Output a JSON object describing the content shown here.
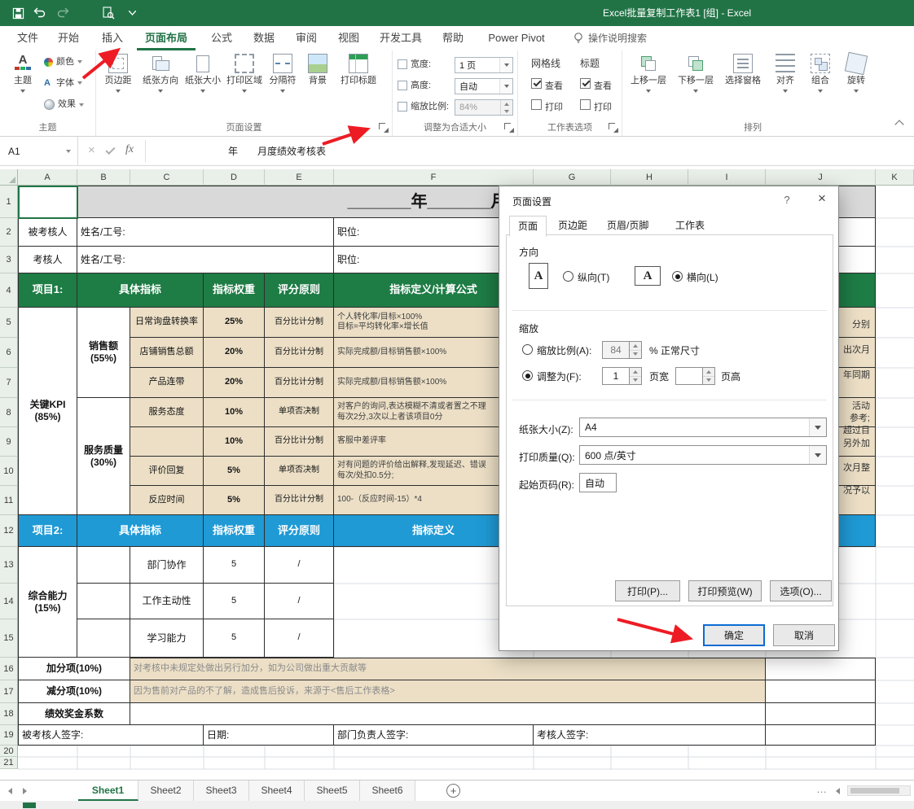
{
  "titlebar": {
    "title": "Excel批量复制工作表1 [组] -  Excel"
  },
  "tabs": {
    "file": "文件",
    "home": "开始",
    "insert": "插入",
    "page_layout": "页面布局",
    "formulas": "公式",
    "data": "数据",
    "review": "审阅",
    "view": "视图",
    "developer": "开发工具",
    "help": "帮助",
    "power_pivot": "Power Pivot",
    "search": "操作说明搜索"
  },
  "ribbon": {
    "themes": {
      "group": "主题",
      "theme": "主题",
      "colors": "颜色",
      "fonts": "字体",
      "effects": "效果"
    },
    "page_setup": {
      "group": "页面设置",
      "margins": "页边距",
      "orientation": "纸张方向",
      "size": "纸张大小",
      "print_area": "打印区域",
      "breaks": "分隔符",
      "background": "背景",
      "print_titles": "打印标题"
    },
    "scale": {
      "group": "调整为合适大小",
      "width_label": "宽度:",
      "width_value": "1 页",
      "height_label": "高度:",
      "height_value": "自动",
      "scale_label": "缩放比例:",
      "scale_value": "84%"
    },
    "sheet_options": {
      "group": "工作表选项",
      "gridlines": "网格线",
      "headings": "标题",
      "view": "查看",
      "print": "打印"
    },
    "arrange": {
      "group": "排列",
      "bring_forward": "上移一层",
      "send_backward": "下移一层",
      "selection_pane": "选择窗格",
      "align": "对齐",
      "group_btn": "组合",
      "rotate": "旋转"
    }
  },
  "formula_bar": {
    "name_box": "A1",
    "fx": "fx",
    "content": "年　　月度绩效考核表"
  },
  "grid": {
    "cols": [
      "A",
      "B",
      "C",
      "D",
      "E",
      "F",
      "G",
      "H",
      "I",
      "J",
      "K"
    ],
    "rows": [
      "1",
      "2",
      "3",
      "4",
      "5",
      "6",
      "7",
      "8",
      "9",
      "10",
      "11",
      "12",
      "13",
      "14",
      "15",
      "16",
      "17",
      "18",
      "19",
      "20",
      "21"
    ]
  },
  "table": {
    "title": "_______年_______月度绩效考核表",
    "assessed_label": "被考核人",
    "assessor_label": "考核人",
    "name_label": "姓名/工号:",
    "position_label": "职位:",
    "p1": {
      "a": "项目1:",
      "b": "具体指标",
      "c": "指标权重",
      "d": "评分原则",
      "e": "指标定义/计算公式"
    },
    "kpi": {
      "l1": "关键KPI",
      "l2": "(85%)"
    },
    "sales": {
      "l1": "销售额",
      "l2": "(55%)"
    },
    "service": {
      "l1": "服务质量",
      "l2": "(30%)"
    },
    "kpi_rows": [
      {
        "name": "日常询盘转换率",
        "weight": "25%",
        "rule": "百分比计分制",
        "d1": "个人转化率/目标×100%",
        "d2": "目标=平均转化率×增长值"
      },
      {
        "name": "店铺销售总额",
        "weight": "20%",
        "rule": "百分比计分制",
        "d1": "实际完成额/目标销售额×100%",
        "d2": ""
      },
      {
        "name": "产品连带",
        "weight": "20%",
        "rule": "百分比计分制",
        "d1": "实际完成额/目标销售额×100%",
        "d2": ""
      },
      {
        "name": "服务态度",
        "weight": "10%",
        "rule": "单项否决制",
        "d1": "对客户的询问,表达模糊不清或者置之不理",
        "d2": "每次2分,3次以上者该项目0分"
      },
      {
        "name": "",
        "weight": "10%",
        "rule": "百分比计分制",
        "d1": "客服中差评率",
        "d2": ""
      },
      {
        "name": "评价回复",
        "weight": "5%",
        "rule": "单项否决制",
        "d1": "对有问题的评价给出解释,发现延迟、错误",
        "d2": "每次/处扣0.5分;"
      },
      {
        "name": "反应时间",
        "weight": "5%",
        "rule": "百分比计分制",
        "d1": "100-（反应时间-15）*4",
        "d2": ""
      }
    ],
    "fragments": [
      "分别",
      "出次月",
      "年同期",
      "活动",
      "参考;",
      "超过目",
      "另外加",
      "次月整",
      "况予以"
    ],
    "p2": {
      "a": "项目2:",
      "b": "具体指标",
      "c": "指标权重",
      "d": "评分原则",
      "e": "指标定义"
    },
    "ability": {
      "l1": "综合能力",
      "l2": "(15%)"
    },
    "ability_rows": [
      {
        "name": "部门协作",
        "weight": "5",
        "rule": "/"
      },
      {
        "name": "工作主动性",
        "weight": "5",
        "rule": "/"
      },
      {
        "name": "学习能力",
        "weight": "5",
        "rule": "/"
      }
    ],
    "bonus_label": "加分项(10%)",
    "bonus_text": "对考核中未规定处做出另行加分，如为公司做出重大贡献等",
    "penalty_label": "减分项(10%)",
    "penalty_text": "因为售前对产品的不了解，造成售后投诉，来源于<售后工作表格>",
    "coef_label": "绩效奖金系数",
    "sign": {
      "a": "被考核人签字:",
      "b": "日期:",
      "c": "部门负责人签字:",
      "d": "考核人签字:"
    }
  },
  "dialog": {
    "title": "页面设置",
    "help": "?",
    "close": "×",
    "tabs": [
      "页面",
      "页边距",
      "页眉/页脚",
      "工作表"
    ],
    "orientation_label": "方向",
    "portrait": "纵向(T)",
    "landscape": "横向(L)",
    "scale_label": "缩放",
    "zoom_label": "缩放比例(A):",
    "zoom_value": "84",
    "zoom_suffix": "% 正常尺寸",
    "fit_label": "调整为(F):",
    "fit_value": "1",
    "fit_width": "页宽",
    "fit_height": "页高",
    "paper_label": "纸张大小(Z):",
    "paper_value": "A4",
    "quality_label": "打印质量(Q):",
    "quality_value": "600 点/英寸",
    "start_label": "起始页码(R):",
    "start_value": "自动",
    "print": "打印(P)...",
    "preview": "打印预览(W)",
    "options": "选项(O)...",
    "ok": "确定",
    "cancel": "取消"
  },
  "sheets": {
    "tabs": [
      "Sheet1",
      "Sheet2",
      "Sheet3",
      "Sheet4",
      "Sheet5",
      "Sheet6"
    ],
    "add": "+"
  }
}
